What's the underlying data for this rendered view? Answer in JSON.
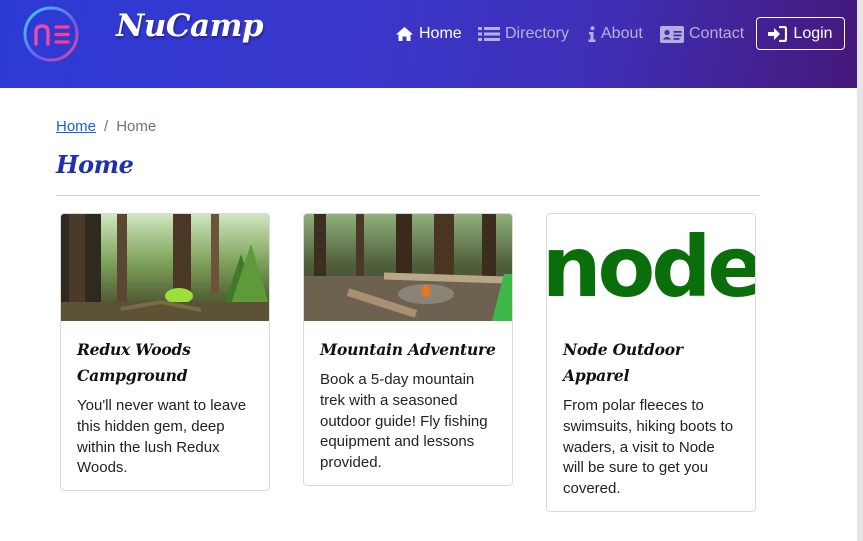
{
  "brand": {
    "name": "NuCamp",
    "logo_icon": "nucamp-logo-icon"
  },
  "nav": {
    "items": [
      {
        "label": "Home",
        "icon": "home-icon",
        "active": true
      },
      {
        "label": "Directory",
        "icon": "list-icon",
        "active": false
      },
      {
        "label": "About",
        "icon": "info-icon",
        "active": false
      },
      {
        "label": "Contact",
        "icon": "address-card-icon",
        "active": false
      }
    ],
    "login_label": "Login",
    "login_icon": "sign-in-icon"
  },
  "breadcrumb": {
    "link": "Home",
    "separator": "/",
    "current": "Home"
  },
  "page_title": "Home",
  "cards": [
    {
      "title": "Redux Woods Campground",
      "text": "You'll never want to leave this hidden gem, deep within the lush Redux Woods.",
      "image": "forest-campsite-photo"
    },
    {
      "title": "Mountain Adventure",
      "text": "Book a 5-day mountain trek with a seasoned outdoor guide! Fly fishing equipment and lessons provided.",
      "image": "campfire-forest-photo"
    },
    {
      "title": "Node Outdoor Apparel",
      "text": "From polar fleeces to swimsuits, hiking boots to waders, a visit to Node will be sure to get you covered.",
      "image": "node-logo",
      "image_text": "node"
    }
  ],
  "colors": {
    "nav_gradient_start": "#2c3ad4",
    "nav_gradient_end": "#45187a",
    "title_color": "#1f2fb0",
    "link_color": "#1a5fd8",
    "node_green": "#0a6e0a"
  }
}
